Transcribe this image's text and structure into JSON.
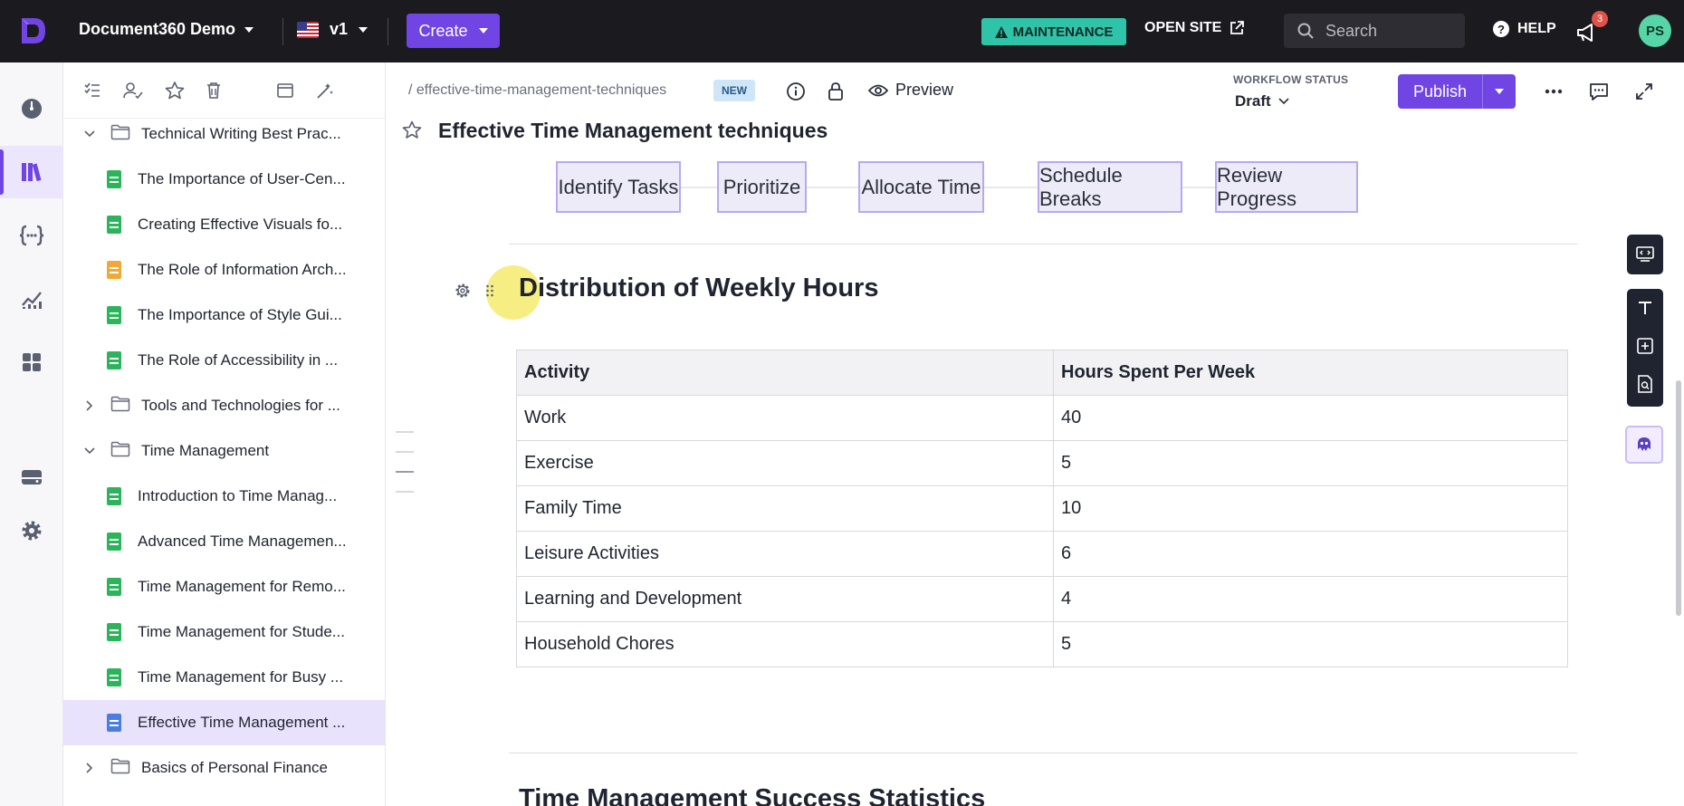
{
  "topbar": {
    "project_name": "Document360 Demo",
    "version": "v1",
    "create_label": "Create",
    "maintenance_label": "MAINTENANCE",
    "open_site_label": "OPEN SITE",
    "search_placeholder": "Search",
    "help_label": "HELP",
    "notification_count": "3",
    "avatar_initials": "PS"
  },
  "rail": {
    "items": [
      "dashboard-icon",
      "documentation-icon",
      "api-icon",
      "analytics-icon",
      "widgets-icon",
      "drive-icon",
      "settings-icon"
    ]
  },
  "tree": {
    "items": [
      {
        "type": "folder",
        "label": "Technical Writing Best Prac...",
        "expanded": true
      },
      {
        "type": "page",
        "label": "The Importance of User-Cen...",
        "color": "green"
      },
      {
        "type": "page",
        "label": "Creating Effective Visuals fo...",
        "color": "green"
      },
      {
        "type": "page",
        "label": "The Role of Information Arch...",
        "color": "orange"
      },
      {
        "type": "page",
        "label": "The Importance of Style Gui...",
        "color": "green"
      },
      {
        "type": "page",
        "label": "The Role of Accessibility in ...",
        "color": "green"
      },
      {
        "type": "folder",
        "label": "Tools and Technologies for ...",
        "expanded": false
      },
      {
        "type": "folder",
        "label": "Time Management",
        "expanded": true
      },
      {
        "type": "page",
        "label": "Introduction to Time Manag...",
        "color": "green"
      },
      {
        "type": "page",
        "label": "Advanced Time Managemen...",
        "color": "green"
      },
      {
        "type": "page",
        "label": "Time Management for Remo...",
        "color": "green"
      },
      {
        "type": "page",
        "label": "Time Management for Stude...",
        "color": "green"
      },
      {
        "type": "page",
        "label": "Time Management for Busy ...",
        "color": "green"
      },
      {
        "type": "page",
        "label": "Effective Time Management ...",
        "color": "blue",
        "selected": true
      },
      {
        "type": "folder",
        "label": "Basics of Personal Finance",
        "expanded": false
      }
    ]
  },
  "editor": {
    "breadcrumb": "/ effective-time-management-techniques",
    "new_badge": "NEW",
    "preview_label": "Preview",
    "workflow_label": "WORKFLOW STATUS",
    "workflow_value": "Draft",
    "publish_label": "Publish",
    "article_title": "Effective Time Management techniques"
  },
  "content": {
    "flow_steps": [
      "Identify Tasks",
      "Prioritize",
      "Allocate Time",
      "Schedule Breaks",
      "Review Progress"
    ],
    "section_heading": "Distribution of Weekly Hours",
    "table": {
      "headers": [
        "Activity",
        "Hours Spent Per Week"
      ],
      "rows": [
        [
          "Work",
          "40"
        ],
        [
          "Exercise",
          "5"
        ],
        [
          "Family Time",
          "10"
        ],
        [
          "Leisure Activities",
          "6"
        ],
        [
          "Learning and Development",
          "4"
        ],
        [
          "Household Chores",
          "5"
        ]
      ]
    },
    "next_heading": "Time Management Success Statistics"
  },
  "colors": {
    "brand": "#7045e4",
    "topbar_bg": "#1b1b1f",
    "maintenance": "#2fc3a8",
    "selected_row": "#e9e2fc"
  }
}
